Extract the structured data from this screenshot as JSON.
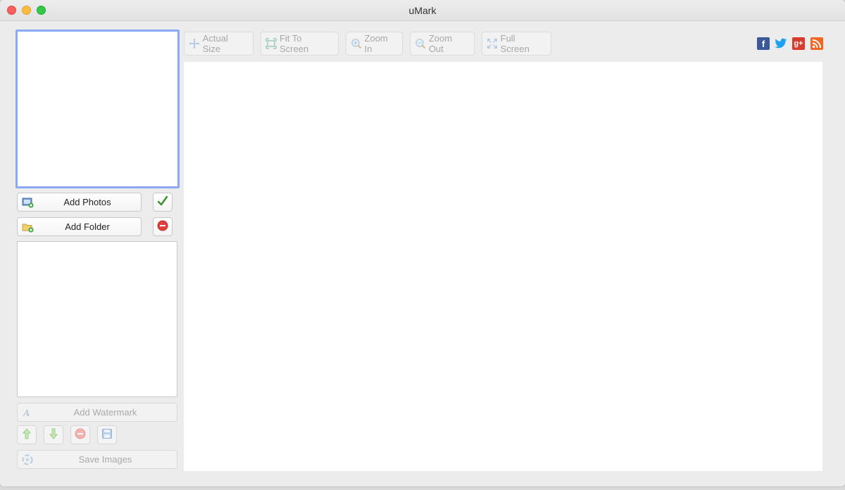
{
  "window": {
    "title": "uMark",
    "controls": [
      "close",
      "minimize",
      "zoom"
    ]
  },
  "toolbar": {
    "actual_size": {
      "label": "Actual Size",
      "icon": "actual-size-icon",
      "enabled": false
    },
    "fit_to_screen": {
      "label": "Fit To Screen",
      "icon": "fit-to-screen-icon",
      "enabled": false
    },
    "zoom_in": {
      "label": "Zoom In",
      "icon": "zoom-in-icon",
      "enabled": false
    },
    "zoom_out": {
      "label": "Zoom Out",
      "icon": "zoom-out-icon",
      "enabled": false
    },
    "full_screen": {
      "label": "Full Screen",
      "icon": "full-screen-icon",
      "enabled": false
    }
  },
  "social": [
    {
      "name": "facebook",
      "glyph": "f",
      "color": "#3b5998"
    },
    {
      "name": "twitter",
      "glyph": "t",
      "color": "#1da1f2"
    },
    {
      "name": "google-plus",
      "glyph": "g+",
      "color": "#d63b2c"
    },
    {
      "name": "rss",
      "glyph": "rss",
      "color": "#f26522"
    }
  ],
  "sidebar": {
    "add_photos": "Add Photos",
    "add_folder": "Add Folder",
    "add_watermark": "Add Watermark",
    "save_images": "Save Images"
  },
  "colors": {
    "accent_border": "#8aabf3",
    "check_green": "#3c8f2e",
    "remove_red": "#e0413d",
    "disabled_text": "#a9a9a9"
  }
}
